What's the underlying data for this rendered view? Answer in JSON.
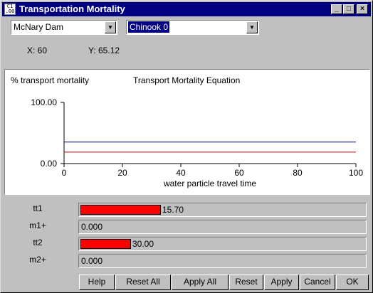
{
  "window": {
    "icon_text": "C1 .00",
    "title": "Transportation Mortality",
    "minimize": "_",
    "maximize": "□",
    "close": "×"
  },
  "selectors": {
    "location": "McNary Dam",
    "species": "Chinook 0"
  },
  "readout": {
    "x_label": "X: 60",
    "y_label": "Y: 65.12"
  },
  "chart_data": {
    "type": "line",
    "title": "Transport Mortality Equation",
    "ylabel": "% transport mortality",
    "xlabel": "water particle travel time",
    "xlim": [
      0,
      100
    ],
    "ylim": [
      0,
      100
    ],
    "x_ticks": [
      "0",
      "20",
      "40",
      "60",
      "80",
      "100"
    ],
    "y_ticks": [
      "0.00",
      "100.00"
    ],
    "series": [
      {
        "color": "#000080",
        "x": [
          0,
          100
        ],
        "y": [
          35.2,
          35.2
        ]
      },
      {
        "color": "#cc0000",
        "x": [
          0,
          100
        ],
        "y": [
          18.8,
          18.8
        ]
      }
    ]
  },
  "params": [
    {
      "label": "tt1",
      "value": "15.70",
      "fill_fraction": 0.283
    },
    {
      "label": "m1+",
      "value": "0.000",
      "fill_fraction": 0
    },
    {
      "label": "tt2",
      "value": "30.00",
      "fill_fraction": 0.179
    },
    {
      "label": "m2+",
      "value": "0.000",
      "fill_fraction": 0
    }
  ],
  "buttons": {
    "help": "Help",
    "reset_all": "Reset All",
    "apply_all": "Apply All",
    "reset": "Reset",
    "apply": "Apply",
    "cancel": "Cancel",
    "ok": "OK"
  }
}
